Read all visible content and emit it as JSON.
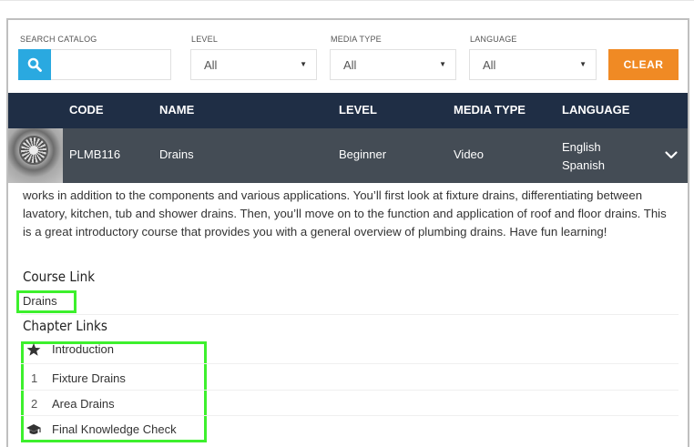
{
  "filters": {
    "search": {
      "label": "SEARCH CATALOG",
      "value": "",
      "placeholder": ""
    },
    "level": {
      "label": "LEVEL",
      "value": "All"
    },
    "media_type": {
      "label": "MEDIA TYPE",
      "value": "All"
    },
    "language": {
      "label": "LANGUAGE",
      "value": "All"
    },
    "clear_label": "CLEAR"
  },
  "table": {
    "headers": {
      "code": "CODE",
      "name": "NAME",
      "level": "LEVEL",
      "media_type": "MEDIA TYPE",
      "language": "LANGUAGE"
    },
    "row": {
      "code": "PLMB116",
      "name": "Drains",
      "level": "Beginner",
      "media_type": "Video",
      "languages": [
        "English",
        "Spanish"
      ]
    }
  },
  "detail": {
    "description": "works in addition to the components and various applications. You’ll first look at fixture drains, differentiating between lavatory, kitchen, tub and shower drains. Then, you’ll move on to the function and application of roof and floor drains. This is a great introductory course that provides you with a general overview of plumbing drains. Have fun learning!",
    "course_link_title": "Course Link",
    "course_link": "Drains",
    "chapter_links_title": "Chapter Links",
    "chapters": [
      {
        "number": "",
        "icon": "star-icon",
        "label": "Introduction"
      },
      {
        "number": "1",
        "icon": "",
        "label": "Fixture Drains"
      },
      {
        "number": "2",
        "icon": "",
        "label": "Area Drains"
      },
      {
        "number": "",
        "icon": "graduation-cap-icon",
        "label": "Final Knowledge Check"
      }
    ]
  },
  "colors": {
    "search_button": "#2aa9e0",
    "clear_button": "#f08a24",
    "table_header": "#1f2e45",
    "table_row": "#444c55",
    "highlight": "#3df02d"
  }
}
